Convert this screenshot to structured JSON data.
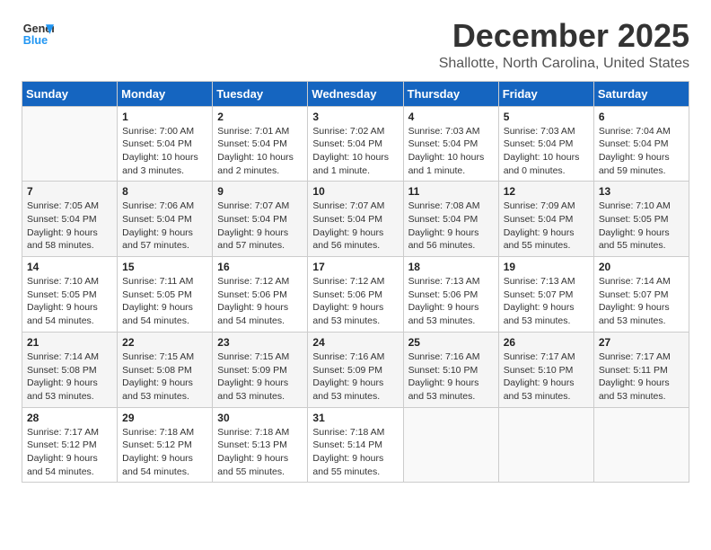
{
  "logo": {
    "line1": "General",
    "line2": "Blue"
  },
  "title": "December 2025",
  "subtitle": "Shallotte, North Carolina, United States",
  "headers": [
    "Sunday",
    "Monday",
    "Tuesday",
    "Wednesday",
    "Thursday",
    "Friday",
    "Saturday"
  ],
  "weeks": [
    [
      {
        "day": "",
        "info": ""
      },
      {
        "day": "1",
        "info": "Sunrise: 7:00 AM\nSunset: 5:04 PM\nDaylight: 10 hours\nand 3 minutes."
      },
      {
        "day": "2",
        "info": "Sunrise: 7:01 AM\nSunset: 5:04 PM\nDaylight: 10 hours\nand 2 minutes."
      },
      {
        "day": "3",
        "info": "Sunrise: 7:02 AM\nSunset: 5:04 PM\nDaylight: 10 hours\nand 1 minute."
      },
      {
        "day": "4",
        "info": "Sunrise: 7:03 AM\nSunset: 5:04 PM\nDaylight: 10 hours\nand 1 minute."
      },
      {
        "day": "5",
        "info": "Sunrise: 7:03 AM\nSunset: 5:04 PM\nDaylight: 10 hours\nand 0 minutes."
      },
      {
        "day": "6",
        "info": "Sunrise: 7:04 AM\nSunset: 5:04 PM\nDaylight: 9 hours\nand 59 minutes."
      }
    ],
    [
      {
        "day": "7",
        "info": "Sunrise: 7:05 AM\nSunset: 5:04 PM\nDaylight: 9 hours\nand 58 minutes."
      },
      {
        "day": "8",
        "info": "Sunrise: 7:06 AM\nSunset: 5:04 PM\nDaylight: 9 hours\nand 57 minutes."
      },
      {
        "day": "9",
        "info": "Sunrise: 7:07 AM\nSunset: 5:04 PM\nDaylight: 9 hours\nand 57 minutes."
      },
      {
        "day": "10",
        "info": "Sunrise: 7:07 AM\nSunset: 5:04 PM\nDaylight: 9 hours\nand 56 minutes."
      },
      {
        "day": "11",
        "info": "Sunrise: 7:08 AM\nSunset: 5:04 PM\nDaylight: 9 hours\nand 56 minutes."
      },
      {
        "day": "12",
        "info": "Sunrise: 7:09 AM\nSunset: 5:04 PM\nDaylight: 9 hours\nand 55 minutes."
      },
      {
        "day": "13",
        "info": "Sunrise: 7:10 AM\nSunset: 5:05 PM\nDaylight: 9 hours\nand 55 minutes."
      }
    ],
    [
      {
        "day": "14",
        "info": "Sunrise: 7:10 AM\nSunset: 5:05 PM\nDaylight: 9 hours\nand 54 minutes."
      },
      {
        "day": "15",
        "info": "Sunrise: 7:11 AM\nSunset: 5:05 PM\nDaylight: 9 hours\nand 54 minutes."
      },
      {
        "day": "16",
        "info": "Sunrise: 7:12 AM\nSunset: 5:06 PM\nDaylight: 9 hours\nand 54 minutes."
      },
      {
        "day": "17",
        "info": "Sunrise: 7:12 AM\nSunset: 5:06 PM\nDaylight: 9 hours\nand 53 minutes."
      },
      {
        "day": "18",
        "info": "Sunrise: 7:13 AM\nSunset: 5:06 PM\nDaylight: 9 hours\nand 53 minutes."
      },
      {
        "day": "19",
        "info": "Sunrise: 7:13 AM\nSunset: 5:07 PM\nDaylight: 9 hours\nand 53 minutes."
      },
      {
        "day": "20",
        "info": "Sunrise: 7:14 AM\nSunset: 5:07 PM\nDaylight: 9 hours\nand 53 minutes."
      }
    ],
    [
      {
        "day": "21",
        "info": "Sunrise: 7:14 AM\nSunset: 5:08 PM\nDaylight: 9 hours\nand 53 minutes."
      },
      {
        "day": "22",
        "info": "Sunrise: 7:15 AM\nSunset: 5:08 PM\nDaylight: 9 hours\nand 53 minutes."
      },
      {
        "day": "23",
        "info": "Sunrise: 7:15 AM\nSunset: 5:09 PM\nDaylight: 9 hours\nand 53 minutes."
      },
      {
        "day": "24",
        "info": "Sunrise: 7:16 AM\nSunset: 5:09 PM\nDaylight: 9 hours\nand 53 minutes."
      },
      {
        "day": "25",
        "info": "Sunrise: 7:16 AM\nSunset: 5:10 PM\nDaylight: 9 hours\nand 53 minutes."
      },
      {
        "day": "26",
        "info": "Sunrise: 7:17 AM\nSunset: 5:10 PM\nDaylight: 9 hours\nand 53 minutes."
      },
      {
        "day": "27",
        "info": "Sunrise: 7:17 AM\nSunset: 5:11 PM\nDaylight: 9 hours\nand 53 minutes."
      }
    ],
    [
      {
        "day": "28",
        "info": "Sunrise: 7:17 AM\nSunset: 5:12 PM\nDaylight: 9 hours\nand 54 minutes."
      },
      {
        "day": "29",
        "info": "Sunrise: 7:18 AM\nSunset: 5:12 PM\nDaylight: 9 hours\nand 54 minutes."
      },
      {
        "day": "30",
        "info": "Sunrise: 7:18 AM\nSunset: 5:13 PM\nDaylight: 9 hours\nand 55 minutes."
      },
      {
        "day": "31",
        "info": "Sunrise: 7:18 AM\nSunset: 5:14 PM\nDaylight: 9 hours\nand 55 minutes."
      },
      {
        "day": "",
        "info": ""
      },
      {
        "day": "",
        "info": ""
      },
      {
        "day": "",
        "info": ""
      }
    ]
  ]
}
